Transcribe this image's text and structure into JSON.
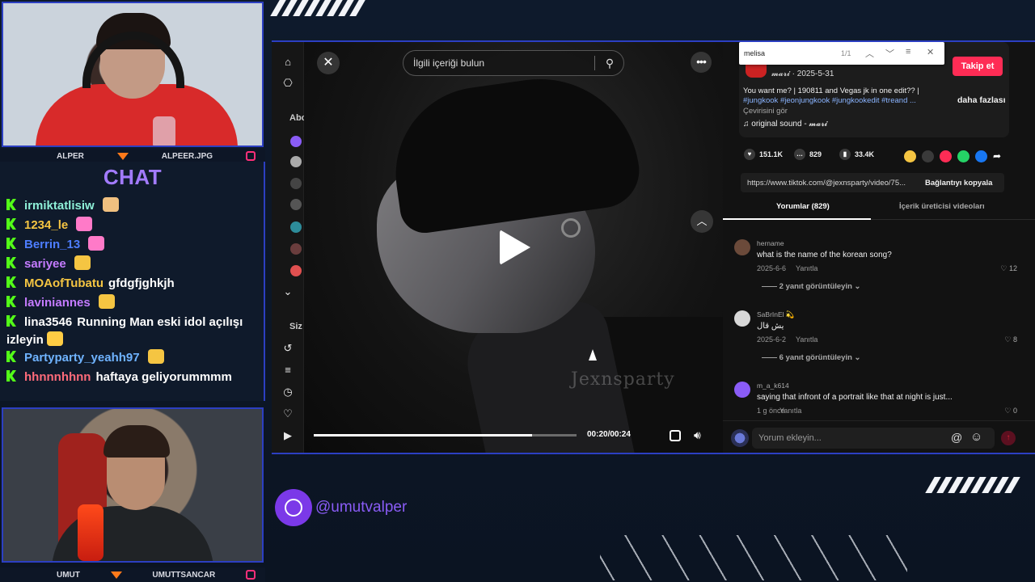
{
  "stream": {
    "top_cam_name_left": "ALPER",
    "top_cam_name_right": "ALPEER.JPG",
    "bottom_cam_name_left": "UMUT",
    "bottom_cam_name_right": "UMUTTSANCAR",
    "chat_title": "CHAT",
    "chat_messages": [
      {
        "user": "irmiktatlisiw",
        "text": "",
        "color": "#8ef0d8"
      },
      {
        "user": "1234_le",
        "text": "",
        "color": "#f5c542"
      },
      {
        "user": "Berrin_13",
        "text": "",
        "color": "#4d7dff"
      },
      {
        "user": "sariyee",
        "text": "",
        "color": "#c47bff"
      },
      {
        "user": "MOAofTubatu",
        "text": "gfdgfjghkjh",
        "color": "#f5c542"
      },
      {
        "user": "laviniannes",
        "text": "",
        "color": "#c47bff"
      },
      {
        "user": "lina3546",
        "text": "Running Man eski idol açılışı izleyin",
        "color": "#ffffff"
      },
      {
        "user": "Partyparty_yeahh97",
        "text": "",
        "color": "#6fb3ff"
      },
      {
        "user": "hhnnnhhnn",
        "text": "haftaya geliyorummmm",
        "color": "#ff6b7a"
      }
    ],
    "social_handle": "@umutvalper"
  },
  "left_nav": {
    "section_following": "Abo",
    "section_you": "Siz"
  },
  "video": {
    "search_placeholder": "İlgili içeriği bulun",
    "watermark": "Jexnsparty",
    "time": "00:20/00:24",
    "progress": 0.83
  },
  "find_bar": {
    "query": "melisa",
    "count": "1/1"
  },
  "post": {
    "author": "𝓶𝓪𝓻𝓲",
    "date": "2025-5-31",
    "follow_label": "Takip et",
    "description": "You want me? | 190811 and Vegas jk in one edit?? |",
    "hashtags": "#jungkook #jeonjungkook #jungkookedit #treand ...",
    "more_label": "daha fazlası",
    "translate_label": "Çevirisini gör",
    "sound": "original sound - 𝓶𝓪𝓻𝓲",
    "likes": "151.1K",
    "comments": "829",
    "saves": "33.4K",
    "link": "https://www.tiktok.com/@jexnsparty/video/75...",
    "copy_link_label": "Bağlantıyı kopyala"
  },
  "tabs": {
    "comments": "Yorumlar (829)",
    "creator_videos": "İçerik üreticisi videoları"
  },
  "comments": [
    {
      "user": "hername",
      "text": "what is the name of the korean song?",
      "date": "2025-6-6",
      "reply": "Yanıtla",
      "likes": "12",
      "replies": "2 yanıt görüntüleyin",
      "avatar_color": "#6b4a3a"
    },
    {
      "user": "SaBrInEl 💫",
      "text": "يش قال",
      "date": "2025-6-2",
      "reply": "Yanıtla",
      "likes": "8",
      "replies": "6 yanıt görüntüleyin",
      "avatar_color": "#d8d8d8"
    },
    {
      "user": "m_a_k614",
      "text": "saying that infront of a portrait like that at night is just...",
      "date": "1 g önce",
      "reply": "Yanıtla",
      "likes": "0",
      "replies": "",
      "avatar_color": "#8a5cf6"
    }
  ],
  "comment_input": {
    "placeholder": "Yorum ekleyin..."
  }
}
